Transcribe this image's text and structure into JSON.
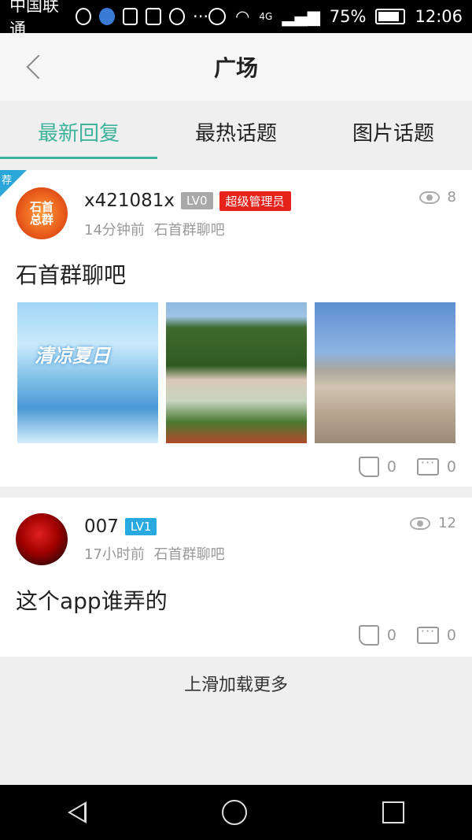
{
  "status_bar": {
    "carrier": "中国联通",
    "signal_text": "4G",
    "battery": "75%",
    "time": "12:06"
  },
  "header": {
    "title": "广场"
  },
  "tabs": [
    {
      "label": "最新回复",
      "active": true
    },
    {
      "label": "最热话题",
      "active": false
    },
    {
      "label": "图片话题",
      "active": false
    }
  ],
  "posts": [
    {
      "recommended_badge": "荐",
      "avatar_text": "石首总群",
      "username": "x421081x",
      "level": "LV0",
      "role_badge": "超级管理员",
      "views": "8",
      "time_ago": "14分钟前",
      "forum": "石首群聊吧",
      "title": "石首群聊吧",
      "images": [
        {
          "caption": "清凉夏日"
        },
        {
          "caption": ""
        },
        {
          "caption": ""
        }
      ],
      "likes": "0",
      "comments": "0"
    },
    {
      "username": "007",
      "level": "LV1",
      "views": "12",
      "time_ago": "17小时前",
      "forum": "石首群聊吧",
      "title": "这个app谁弄的",
      "likes": "0",
      "comments": "0"
    }
  ],
  "load_more": "上滑加载更多",
  "colors": {
    "accent": "#3cb39a",
    "admin_badge": "#e5231b",
    "lv1_badge": "#28a9e0",
    "lv0_badge": "#a9a9a9"
  }
}
